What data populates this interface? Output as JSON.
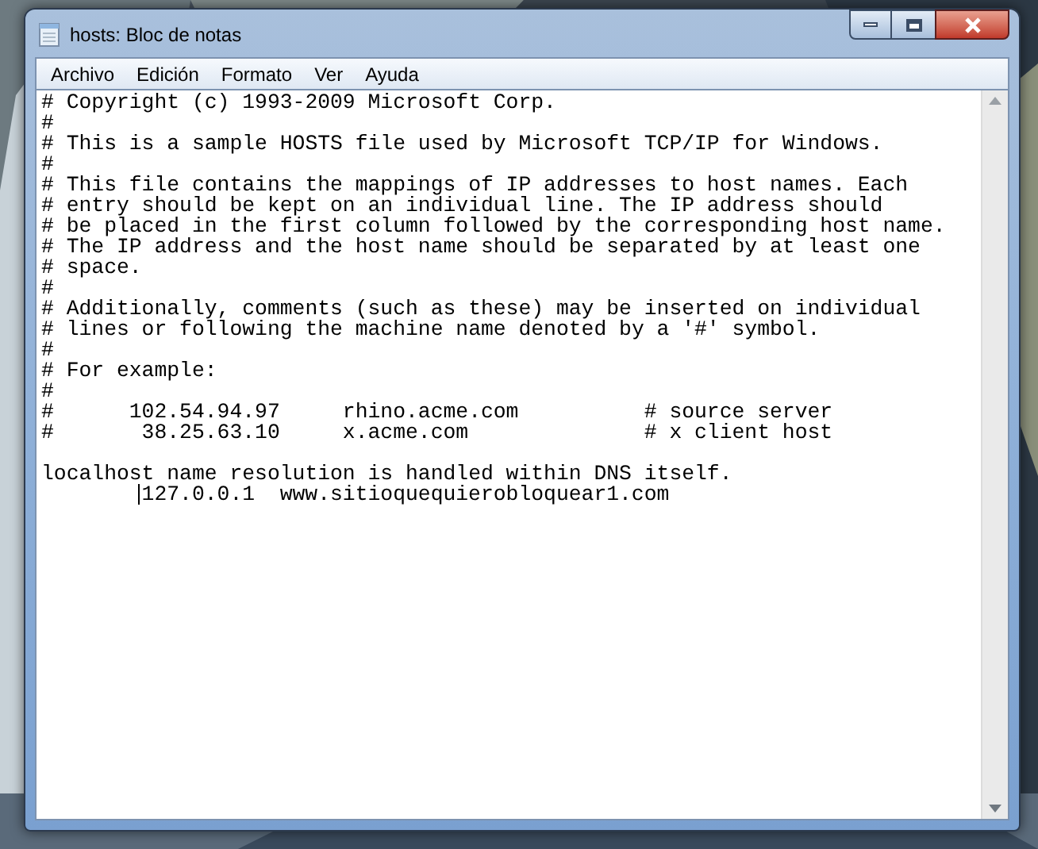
{
  "window": {
    "title": "hosts: Bloc de notas"
  },
  "menu": [
    "Archivo",
    "Edición",
    "Formato",
    "Ver",
    "Ayuda"
  ],
  "document": {
    "blocks": [
      [
        "# Copyright (c) 1993-2009 Microsoft Corp.",
        "#",
        "# This is a sample HOSTS file used by Microsoft TCP/IP for Windows.",
        "#",
        "# This file contains the mappings of IP addresses to host names. Each",
        "# entry should be kept on an individual line. The IP address should",
        "# be placed in the first column followed by the corresponding host name.",
        "# The IP address and the host name should be separated by at least one",
        "# space.",
        "#",
        "# Additionally, comments (such as these) may be inserted on individual",
        "# lines or following the machine name denoted by a '#' symbol.",
        "#",
        "# For example:",
        "#",
        "#      102.54.94.97     rhino.acme.com          # source server",
        "#       38.25.63.10     x.acme.com              # x client host"
      ],
      [
        "localhost name resolution is handled within DNS itself.",
        "        127.0.0.1  www.sitioquequierobloquear1.com"
      ]
    ]
  }
}
